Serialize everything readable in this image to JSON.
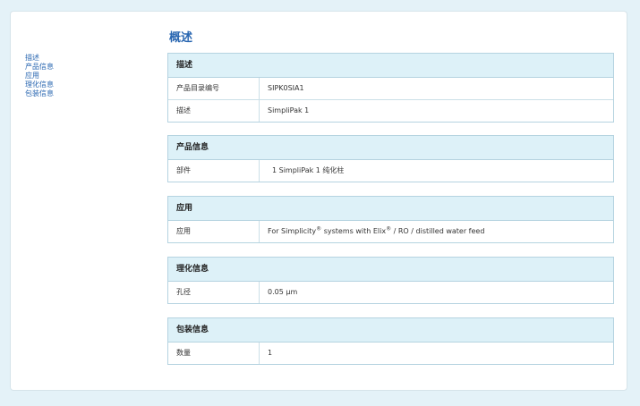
{
  "title": "概述",
  "nav": [
    "描述",
    "产品信息",
    "应用",
    "理化信息",
    "包装信息"
  ],
  "sections": [
    {
      "header": "描述",
      "rows": [
        {
          "label": "产品目录编号",
          "value": "SIPK0SIA1"
        },
        {
          "label": "描述",
          "value": "SimpliPak 1"
        }
      ]
    },
    {
      "header": "产品信息",
      "rows": [
        {
          "label": "部件",
          "value": "1 SimpliPak 1 纯化柱"
        }
      ]
    },
    {
      "header": "应用",
      "rows": [
        {
          "label": "应用",
          "value_parts": [
            "For Simplicity",
            "®",
            " systems with Elix",
            "®",
            " / RO / distilled water feed"
          ]
        }
      ]
    },
    {
      "header": "理化信息",
      "rows": [
        {
          "label": "孔径",
          "value": "0.05 µm"
        }
      ]
    },
    {
      "header": "包装信息",
      "rows": [
        {
          "label": "数量",
          "value": "1"
        }
      ]
    }
  ]
}
